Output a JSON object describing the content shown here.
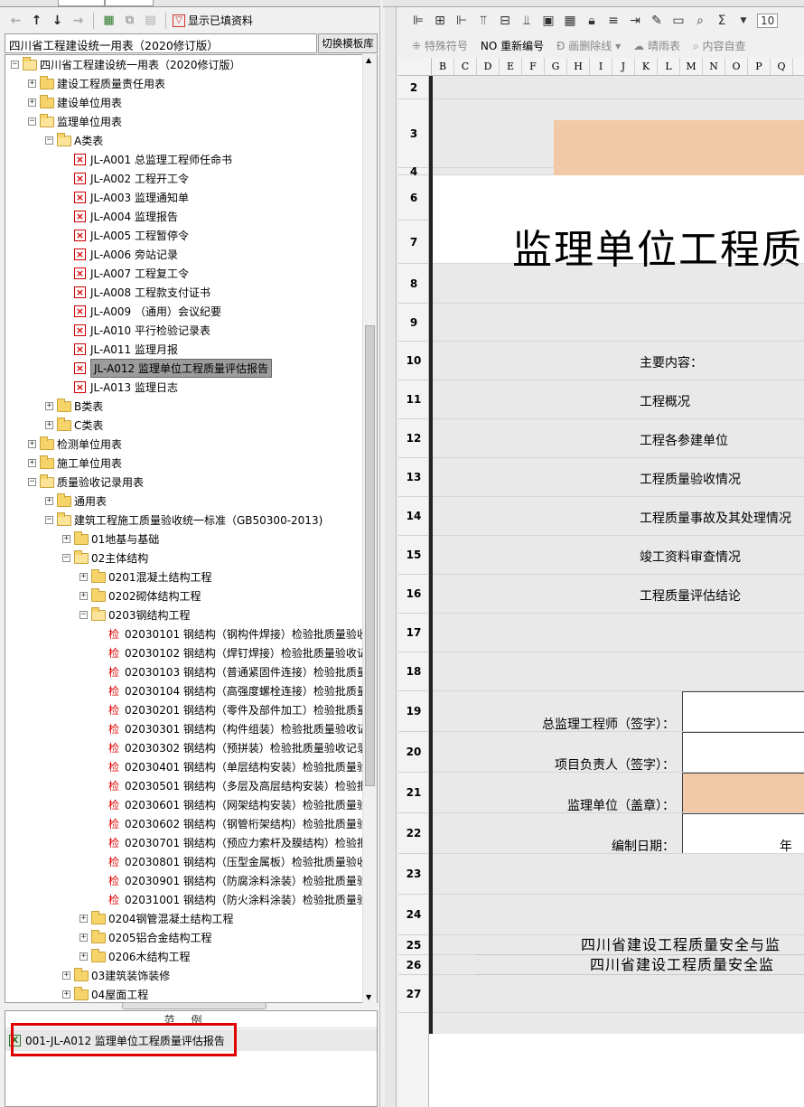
{
  "left": {
    "toolbar": {
      "show_filled_label": "显示已填资料"
    },
    "library_name": "四川省工程建设统一用表（2020修订版）",
    "switch_button": "切换模板库",
    "tree": [
      {
        "level": 0,
        "type": "folder-open",
        "exp": "-",
        "label": "四川省工程建设统一用表（2020修订版）"
      },
      {
        "level": 1,
        "type": "folder",
        "exp": "+",
        "label": "建设工程质量责任用表"
      },
      {
        "level": 1,
        "type": "folder",
        "exp": "+",
        "label": "建设单位用表"
      },
      {
        "level": 1,
        "type": "folder-open",
        "exp": "-",
        "label": "监理单位用表"
      },
      {
        "level": 2,
        "type": "folder-open",
        "exp": "-",
        "label": "A类表"
      },
      {
        "level": 3,
        "type": "form",
        "label": "JL-A001 总监理工程师任命书"
      },
      {
        "level": 3,
        "type": "form",
        "label": "JL-A002 工程开工令"
      },
      {
        "level": 3,
        "type": "form",
        "label": "JL-A003 监理通知单"
      },
      {
        "level": 3,
        "type": "form",
        "label": "JL-A004 监理报告"
      },
      {
        "level": 3,
        "type": "form",
        "label": "JL-A005 工程暂停令"
      },
      {
        "level": 3,
        "type": "form",
        "label": "JL-A006 旁站记录"
      },
      {
        "level": 3,
        "type": "form",
        "label": "JL-A007 工程复工令"
      },
      {
        "level": 3,
        "type": "form",
        "label": "JL-A008 工程款支付证书"
      },
      {
        "level": 3,
        "type": "form",
        "label": "JL-A009 （通用）会议纪要"
      },
      {
        "level": 3,
        "type": "form",
        "label": "JL-A010 平行检验记录表"
      },
      {
        "level": 3,
        "type": "form",
        "label": "JL-A011 监理月报"
      },
      {
        "level": 3,
        "type": "form",
        "label": "JL-A012 监理单位工程质量评估报告",
        "selected": true
      },
      {
        "level": 3,
        "type": "form",
        "label": "JL-A013 监理日志"
      },
      {
        "level": 2,
        "type": "folder",
        "exp": "+",
        "label": "B类表"
      },
      {
        "level": 2,
        "type": "folder",
        "exp": "+",
        "label": "C类表"
      },
      {
        "level": 1,
        "type": "folder",
        "exp": "+",
        "label": "检测单位用表"
      },
      {
        "level": 1,
        "type": "folder",
        "exp": "+",
        "label": "施工单位用表"
      },
      {
        "level": 1,
        "type": "folder-open",
        "exp": "-",
        "label": "质量验收记录用表"
      },
      {
        "level": 2,
        "type": "folder",
        "exp": "+",
        "label": "通用表"
      },
      {
        "level": 2,
        "type": "folder-open",
        "exp": "-",
        "label": "建筑工程施工质量验收统一标准（GB50300-2013)"
      },
      {
        "level": 3,
        "type": "folder",
        "exp": "+",
        "label": "01地基与基础"
      },
      {
        "level": 3,
        "type": "folder-open",
        "exp": "-",
        "label": "02主体结构"
      },
      {
        "level": 4,
        "type": "folder",
        "exp": "+",
        "label": "0201混凝土结构工程"
      },
      {
        "level": 4,
        "type": "folder",
        "exp": "+",
        "label": "0202砌体结构工程"
      },
      {
        "level": 4,
        "type": "folder-open",
        "exp": "-",
        "label": "0203钢结构工程"
      },
      {
        "level": 5,
        "type": "check",
        "label": "02030101 钢结构（钢构件焊接）检验批质量验收"
      },
      {
        "level": 5,
        "type": "check",
        "label": "02030102 钢结构（焊钉焊接）检验批质量验收记"
      },
      {
        "level": 5,
        "type": "check",
        "label": "02030103 钢结构（普通紧固件连接）检验批质量"
      },
      {
        "level": 5,
        "type": "check",
        "label": "02030104 钢结构（高强度螺栓连接）检验批质量"
      },
      {
        "level": 5,
        "type": "check",
        "label": "02030201 钢结构（零件及部件加工）检验批质量"
      },
      {
        "level": 5,
        "type": "check",
        "label": "02030301 钢结构（构件组装）检验批质量验收记"
      },
      {
        "level": 5,
        "type": "check",
        "label": "02030302 钢结构（预拼装）检验批质量验收记录"
      },
      {
        "level": 5,
        "type": "check",
        "label": "02030401 钢结构（单层结构安装）检验批质量验"
      },
      {
        "level": 5,
        "type": "check",
        "label": "02030501 钢结构（多层及高层结构安装）检验批"
      },
      {
        "level": 5,
        "type": "check",
        "label": "02030601 钢结构（网架结构安装）检验批质量验"
      },
      {
        "level": 5,
        "type": "check",
        "label": "02030602 钢结构（钢管桁架结构）检验批质量验"
      },
      {
        "level": 5,
        "type": "check",
        "label": "02030701 钢结构（预应力索杆及膜结构）检验批"
      },
      {
        "level": 5,
        "type": "check",
        "label": "02030801 钢结构（压型金属板）检验批质量验收"
      },
      {
        "level": 5,
        "type": "check",
        "label": "02030901 钢结构（防腐涂料涂装）检验批质量验"
      },
      {
        "level": 5,
        "type": "check",
        "label": "02031001 钢结构（防火涂料涂装）检验批质量验"
      },
      {
        "level": 4,
        "type": "folder",
        "exp": "+",
        "label": "0204钢管混凝土结构工程"
      },
      {
        "level": 4,
        "type": "folder",
        "exp": "+",
        "label": "0205铝合金结构工程"
      },
      {
        "level": 4,
        "type": "folder",
        "exp": "+",
        "label": "0206木结构工程"
      },
      {
        "level": 3,
        "type": "folder",
        "exp": "+",
        "label": "03建筑装饰装修"
      },
      {
        "level": 3,
        "type": "folder",
        "exp": "+",
        "label": "04屋面工程"
      }
    ],
    "legend_header": "范例",
    "legend_item": "001-JL-A012 监理单位工程质量评估报告"
  },
  "right": {
    "toolbar2": {
      "special_symbol": "特殊符号",
      "renumber": "重新编号",
      "strike": "画删除线",
      "weather": "晴雨表",
      "self_check": "内容自查"
    },
    "sum_symbol": "Σ",
    "font_size_partial": "10",
    "columns": [
      "B",
      "C",
      "D",
      "E",
      "F",
      "G",
      "H",
      "I",
      "J",
      "K",
      "L",
      "M",
      "N",
      "O",
      "P",
      "Q"
    ],
    "rows": [
      {
        "n": "2",
        "h": 26
      },
      {
        "n": "3",
        "h": 76
      },
      {
        "n": "4",
        "h": 8
      },
      {
        "n": "6",
        "h": 50
      },
      {
        "n": "7",
        "h": 48
      },
      {
        "n": "8",
        "h": 44
      },
      {
        "n": "9",
        "h": 42
      },
      {
        "n": "10",
        "h": 43
      },
      {
        "n": "11",
        "h": 43
      },
      {
        "n": "12",
        "h": 43
      },
      {
        "n": "13",
        "h": 43
      },
      {
        "n": "14",
        "h": 43
      },
      {
        "n": "15",
        "h": 43
      },
      {
        "n": "16",
        "h": 43
      },
      {
        "n": "17",
        "h": 43
      },
      {
        "n": "18",
        "h": 43
      },
      {
        "n": "19",
        "h": 45
      },
      {
        "n": "20",
        "h": 45
      },
      {
        "n": "21",
        "h": 45
      },
      {
        "n": "22",
        "h": 45
      },
      {
        "n": "23",
        "h": 45
      },
      {
        "n": "24",
        "h": 45
      },
      {
        "n": "25",
        "h": 22
      },
      {
        "n": "26",
        "h": 22
      },
      {
        "n": "27",
        "h": 42
      }
    ],
    "doc_title": "监理单位工程质量评",
    "items": [
      "主要内容：",
      "工程概况",
      "工程各参建单位",
      "工程质量验收情况",
      "工程质量事故及其处理情况",
      "竣工资料审查情况",
      "工程质量评估结论"
    ],
    "signatures": {
      "chief": "总监理工程师（签字）：",
      "pm": "项目负责人（签字）：",
      "unit": "监理单位（盖章）：",
      "date": "编制日期：",
      "year": "年"
    },
    "footer": [
      "四川省建设工程质量安全与监",
      "四川省建设工程质量安全监"
    ]
  }
}
